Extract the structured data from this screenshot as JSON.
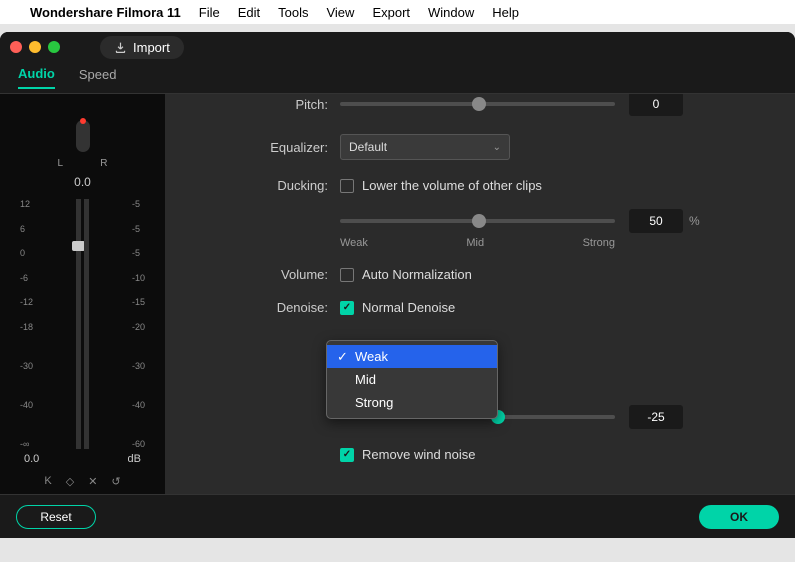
{
  "menubar": {
    "app": "Wondershare Filmora 11",
    "items": [
      "File",
      "Edit",
      "Tools",
      "View",
      "Export",
      "Window",
      "Help"
    ]
  },
  "import_label": "Import",
  "tabs": {
    "audio": "Audio",
    "speed": "Speed"
  },
  "meter": {
    "l": "L",
    "r": "R",
    "pan_value": "0.0",
    "left_scale": [
      "12",
      "6",
      "0",
      "-6",
      "-12",
      "-18",
      "",
      "-30",
      "",
      "-40",
      "",
      "-∞"
    ],
    "right_scale": [
      "-5",
      "-5",
      "-5",
      "-10",
      "-15",
      "-20",
      "",
      "-30",
      "",
      "-40",
      "",
      "-60"
    ],
    "bottom_value": "0.0",
    "bottom_unit": "dB"
  },
  "controls": {
    "pitch_label": "Pitch:",
    "pitch_value": "0",
    "equalizer_label": "Equalizer:",
    "equalizer_value": "Default",
    "ducking_label": "Ducking:",
    "ducking_check": "Lower the volume of other clips",
    "ducking_value": "50",
    "ducking_pct": "%",
    "ducking_weak": "Weak",
    "ducking_mid": "Mid",
    "ducking_strong": "Strong",
    "volume_label": "Volume:",
    "volume_check": "Auto Normalization",
    "denoise_label": "Denoise:",
    "denoise_check": "Normal Denoise",
    "denoise_slider_value": "-25",
    "wind_check": "Remove wind noise",
    "popup": {
      "weak": "Weak",
      "mid": "Mid",
      "strong": "Strong"
    }
  },
  "footer": {
    "reset": "Reset",
    "ok": "OK"
  }
}
